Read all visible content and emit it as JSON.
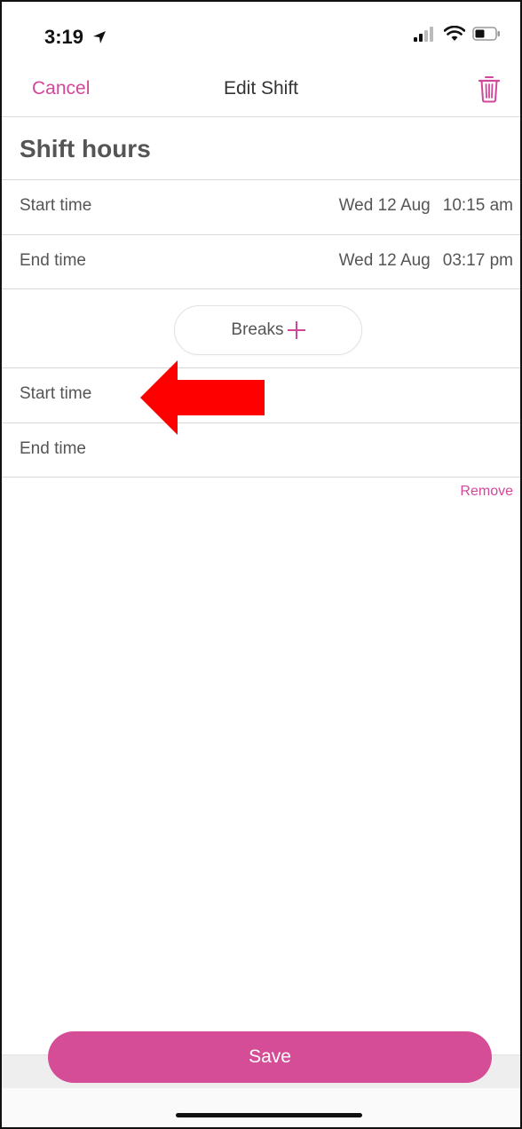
{
  "status_bar": {
    "time": "3:19",
    "icons": [
      "location-arrow-icon",
      "cellular-signal-icon",
      "wifi-icon",
      "battery-icon"
    ]
  },
  "nav": {
    "cancel_label": "Cancel",
    "title": "Edit Shift",
    "trash_icon": "trash-icon"
  },
  "shift_hours": {
    "title": "Shift hours",
    "start": {
      "label": "Start time",
      "date": "Wed 12 Aug",
      "time": "10:15 am"
    },
    "end": {
      "label": "End time",
      "date": "Wed 12 Aug",
      "time": "03:17 pm"
    }
  },
  "breaks": {
    "button_label": "Breaks",
    "start_label": "Start time",
    "end_label": "End time",
    "remove_label": "Remove"
  },
  "footer": {
    "save_label": "Save"
  },
  "colors": {
    "accent": "#d2479a",
    "save_button": "#d44d96",
    "annotation_arrow": "#ff0000"
  }
}
